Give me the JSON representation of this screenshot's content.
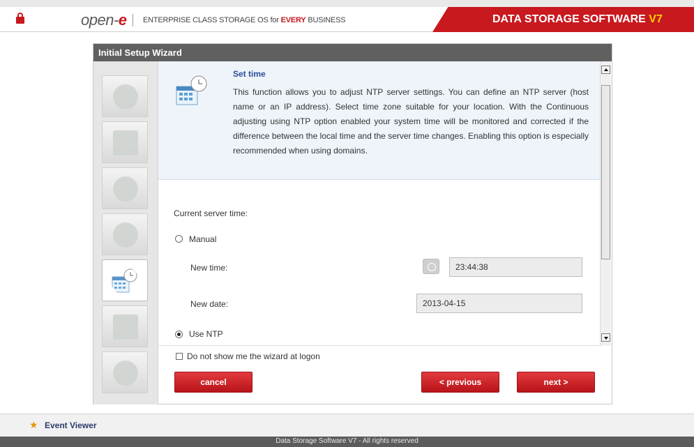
{
  "header": {
    "logo_text": "open-",
    "logo_accent": "e",
    "tagline_pre": "ENTERPRISE CLASS STORAGE OS for ",
    "tagline_accent": "EVERY",
    "tagline_post": " BUSINESS",
    "brand": "DATA STORAGE SOFTWARE ",
    "brand_version": "V7",
    "accent_color": "#c8191f"
  },
  "wizard": {
    "title": "Initial Setup Wizard",
    "steps": [
      {
        "icon": "globe-icon"
      },
      {
        "icon": "monitor-lock-icon"
      },
      {
        "icon": "network-icon"
      },
      {
        "icon": "disk-icon"
      },
      {
        "icon": "calendar-clock-icon",
        "active": true
      },
      {
        "icon": "monitor-icon"
      },
      {
        "icon": "info-icon"
      }
    ]
  },
  "info": {
    "title": "Set time",
    "text": "This function allows you to adjust NTP server settings. You can define an NTP server (host name or an IP address). Select time zone suitable for your location. With the Continuous adjusting using NTP option enabled your system time will be monitored and corrected if the difference between the local time and the server time changes. Enabling this option is especially recommended when using domains."
  },
  "form": {
    "current_server_time_label": "Current server time:",
    "manual_label": "Manual",
    "new_time_label": "New time:",
    "new_time_value": "23:44:38",
    "new_date_label": "New date:",
    "new_date_value": "2013-04-15",
    "use_ntp_label": "Use NTP",
    "selected_mode": "Use NTP"
  },
  "footer_controls": {
    "checkbox_label": "Do not show me the wizard at logon",
    "cancel": "cancel",
    "previous": "< previous",
    "next": "next >"
  },
  "bottom": {
    "event_viewer": "Event Viewer",
    "copyright": "Data Storage Software V7 - All rights reserved"
  }
}
